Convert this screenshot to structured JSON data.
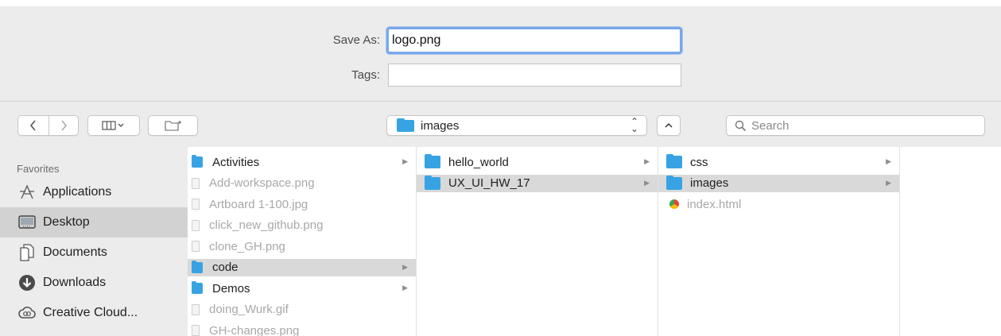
{
  "save": {
    "save_as_label": "Save As:",
    "save_as_value": "logo.png",
    "tags_label": "Tags:",
    "tags_value": ""
  },
  "toolbar": {
    "back_glyph": "‹",
    "forward_glyph": "›",
    "view_glyph": "▥⌄",
    "location": "images",
    "collapse_glyph": "⌃",
    "search_placeholder": "Search"
  },
  "sidebar": {
    "heading": "Favorites",
    "items": [
      {
        "label": "Applications",
        "icon": "applications-icon",
        "selected": false
      },
      {
        "label": "Desktop",
        "icon": "desktop-icon",
        "selected": true
      },
      {
        "label": "Documents",
        "icon": "documents-icon",
        "selected": false
      },
      {
        "label": "Downloads",
        "icon": "downloads-icon",
        "selected": false
      },
      {
        "label": "Creative Cloud...",
        "icon": "creative-cloud-icon",
        "selected": false
      }
    ]
  },
  "columns": [
    {
      "items": [
        {
          "name": "Activities",
          "type": "folder",
          "arrow": true,
          "selected": false,
          "dim": false
        },
        {
          "name": "Add-workspace.png",
          "type": "file",
          "arrow": false,
          "selected": false,
          "dim": true
        },
        {
          "name": "Artboard 1-100.jpg",
          "type": "file",
          "arrow": false,
          "selected": false,
          "dim": true
        },
        {
          "name": "click_new_github.png",
          "type": "file",
          "arrow": false,
          "selected": false,
          "dim": true
        },
        {
          "name": "clone_GH.png",
          "type": "file",
          "arrow": false,
          "selected": false,
          "dim": true
        },
        {
          "name": "code",
          "type": "folder",
          "arrow": true,
          "selected": true,
          "dim": false
        },
        {
          "name": "Demos",
          "type": "folder",
          "arrow": true,
          "selected": false,
          "dim": false
        },
        {
          "name": "doing_Wurk.gif",
          "type": "file",
          "arrow": false,
          "selected": false,
          "dim": true
        },
        {
          "name": "GH-changes.png",
          "type": "file",
          "arrow": false,
          "selected": false,
          "dim": true
        }
      ]
    },
    {
      "items": [
        {
          "name": "hello_world",
          "type": "folder",
          "arrow": true,
          "selected": false,
          "dim": false
        },
        {
          "name": "UX_UI_HW_17",
          "type": "folder",
          "arrow": true,
          "selected": true,
          "dim": false
        }
      ]
    },
    {
      "items": [
        {
          "name": "css",
          "type": "folder",
          "arrow": true,
          "selected": false,
          "dim": false
        },
        {
          "name": "images",
          "type": "folder",
          "arrow": true,
          "selected": true,
          "dim": false
        },
        {
          "name": "index.html",
          "type": "html",
          "arrow": false,
          "selected": false,
          "dim": true
        }
      ]
    }
  ],
  "colors": {
    "folder": "#37a3e4",
    "focus_ring": "#7aa7e8",
    "selection": "#d9d9d9"
  }
}
